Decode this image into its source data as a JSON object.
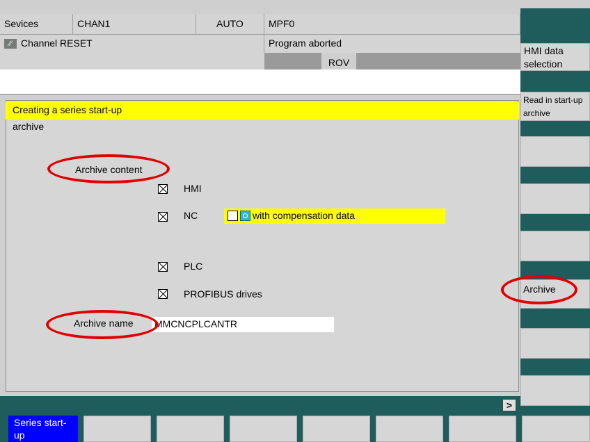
{
  "header": {
    "area": "Sevices",
    "channel": "CHAN1",
    "mode": "AUTO",
    "program": "MPF0",
    "channel_status": "Channel RESET",
    "program_status": "Program aborted",
    "rov": "ROV"
  },
  "panel": {
    "title_line1": "Creating a series  start-up",
    "title_line2": "archive",
    "archive_content_label": "Archive content",
    "items": [
      {
        "label": "HMI",
        "checked": true
      },
      {
        "label": "NC",
        "checked": true
      },
      {
        "label": "PLC",
        "checked": true
      },
      {
        "label": "PROFIBUS drives",
        "checked": true
      }
    ],
    "compensation_label": "with compensation data",
    "archive_name_label": "Archive name",
    "archive_name_value": "MMCNCPLCANTR"
  },
  "vertical_softkeys": {
    "hmi_data_selection": "HMI data selection",
    "read_in": "Read in start-up archive",
    "archive": "Archive"
  },
  "horizontal_softkeys": {
    "series_startup": "Series start-up",
    "more": ">"
  },
  "colors": {
    "highlight": "#ffff00",
    "teal": "#1f5c5c",
    "softkey_active": "#0000ff",
    "annotation_ring": "#e00000"
  }
}
